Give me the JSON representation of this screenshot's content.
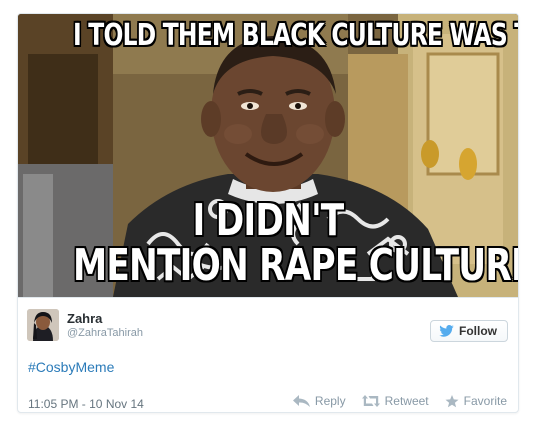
{
  "meme": {
    "top_text": "I TOLD THEM BLACK CULTURE WAS TO BLAME",
    "bottom_line_1": "I DIDN'T",
    "bottom_line_2": "MENTION RAPE CULTURE"
  },
  "author": {
    "name": "Zahra",
    "handle": "@ZahraTahirah"
  },
  "follow_label": "Follow",
  "tweet_text": "#CosbyMeme",
  "timestamp": "11:05 PM - 10 Nov 14",
  "actions": {
    "reply": "Reply",
    "retweet": "Retweet",
    "favorite": "Favorite"
  },
  "colors": {
    "link": "#2b7bb9",
    "twitter_blue": "#55acee",
    "muted": "#8899a6"
  },
  "icons": [
    "twitter-bird-icon",
    "reply-icon",
    "retweet-icon",
    "favorite-star-icon"
  ]
}
